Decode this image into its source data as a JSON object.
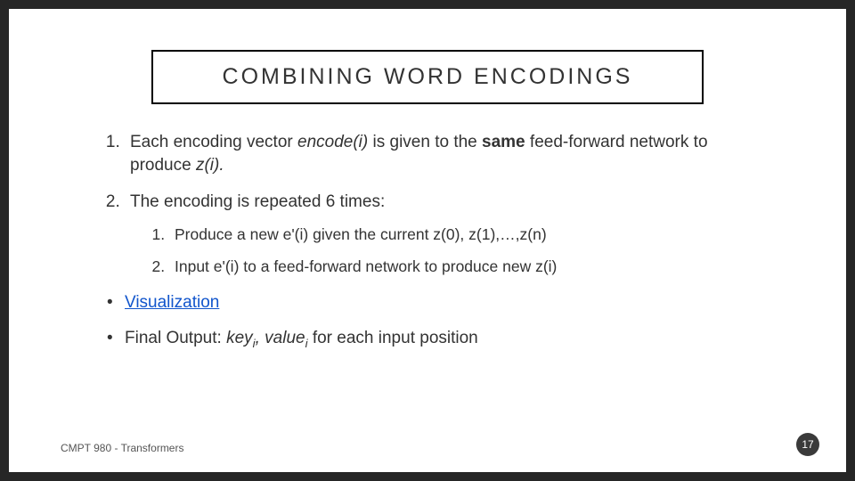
{
  "title": "COMBINING WORD ENCODINGS",
  "item1": {
    "p1": "Each encoding vector ",
    "p2": "encode(i)",
    "p3": " is given to the ",
    "p4": "same",
    "p5": " feed-forward network to produce ",
    "p6": "z(i).",
    "p7": ""
  },
  "item2": {
    "lead": "The encoding is repeated 6 times:",
    "sub1": "Produce a new e'(i) given the current z(0), z(1),…,z(n)",
    "sub2": "Input e'(i) to a feed-forward network to produce new z(i)"
  },
  "bullet1": "Visualization",
  "bullet2": {
    "p1": "Final Output: ",
    "p2": "key",
    "p3": "i",
    "p4": ", value",
    "p5": "i",
    "p6": " for each input position"
  },
  "footer": "CMPT 980 - Transformers",
  "page": "17"
}
